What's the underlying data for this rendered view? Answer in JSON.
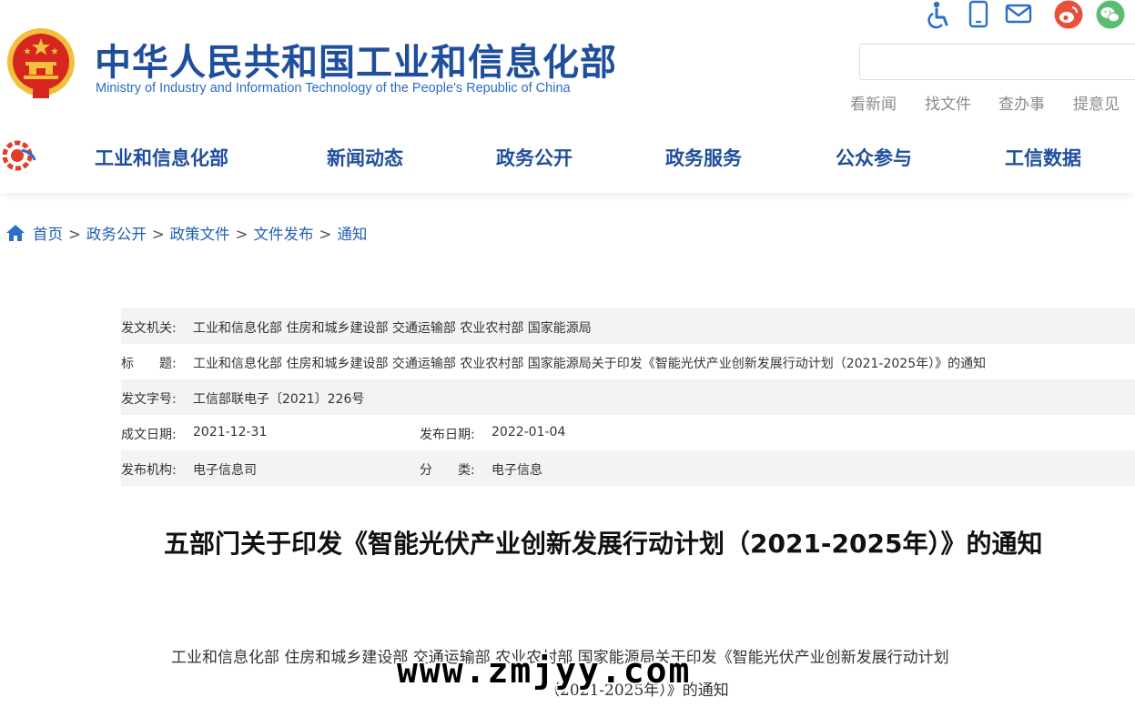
{
  "header": {
    "title_cn": "中华人民共和国工业和信息化部",
    "title_en": "Ministry of Industry and Information Technology of the People's Republic of China",
    "search": {
      "value": "",
      "placeholder": ""
    },
    "quick_links": [
      "看新闻",
      "找文件",
      "查办事",
      "提意见"
    ],
    "top_icons": [
      "accessibility-icon",
      "mobile-icon",
      "mail-icon",
      "weibo-icon",
      "wechat-icon"
    ],
    "colors": {
      "brand_blue": "#1f4f9c",
      "weibo": "#e6513c",
      "wechat": "#5bbd72",
      "emblem_red": "#d6261f",
      "emblem_gold": "#f3c03b"
    }
  },
  "nav": {
    "items": [
      "工业和信息化部",
      "新闻动态",
      "政务公开",
      "政务服务",
      "公众参与",
      "工信数据"
    ]
  },
  "breadcrumb": [
    "首页",
    "政务公开",
    "政策文件",
    "文件发布",
    "通知"
  ],
  "meta": {
    "issuer_label": "发文机关:",
    "issuer": "工业和信息化部 住房和城乡建设部 交通运输部 农业农村部 国家能源局",
    "title_label": "标　　题:",
    "title": "工业和信息化部 住房和城乡建设部 交通运输部 农业农村部 国家能源局关于印发《智能光伏产业创新发展行动计划（2021-2025年）》的通知",
    "doc_no_label": "发文字号:",
    "doc_no": "工信部联电子〔2021〕226号",
    "created_label": "成文日期:",
    "created": "2021-12-31",
    "published_label": "发布日期:",
    "published": "2022-01-04",
    "agency_label": "发布机构:",
    "agency": "电子信息司",
    "category_label": "分　　类:",
    "category": "电子信息"
  },
  "article": {
    "title": "五部门关于印发《智能光伏产业创新发展行动计划（2021-2025年）》的通知",
    "intro_line1": "工业和信息化部 住房和城乡建设部 交通运输部 农业农村部 国家能源局关于印发《智能光伏产业创新发展行动计划",
    "intro_line2": "（2021-2025年）》的通知"
  },
  "watermark": "www.zmjyy.com"
}
